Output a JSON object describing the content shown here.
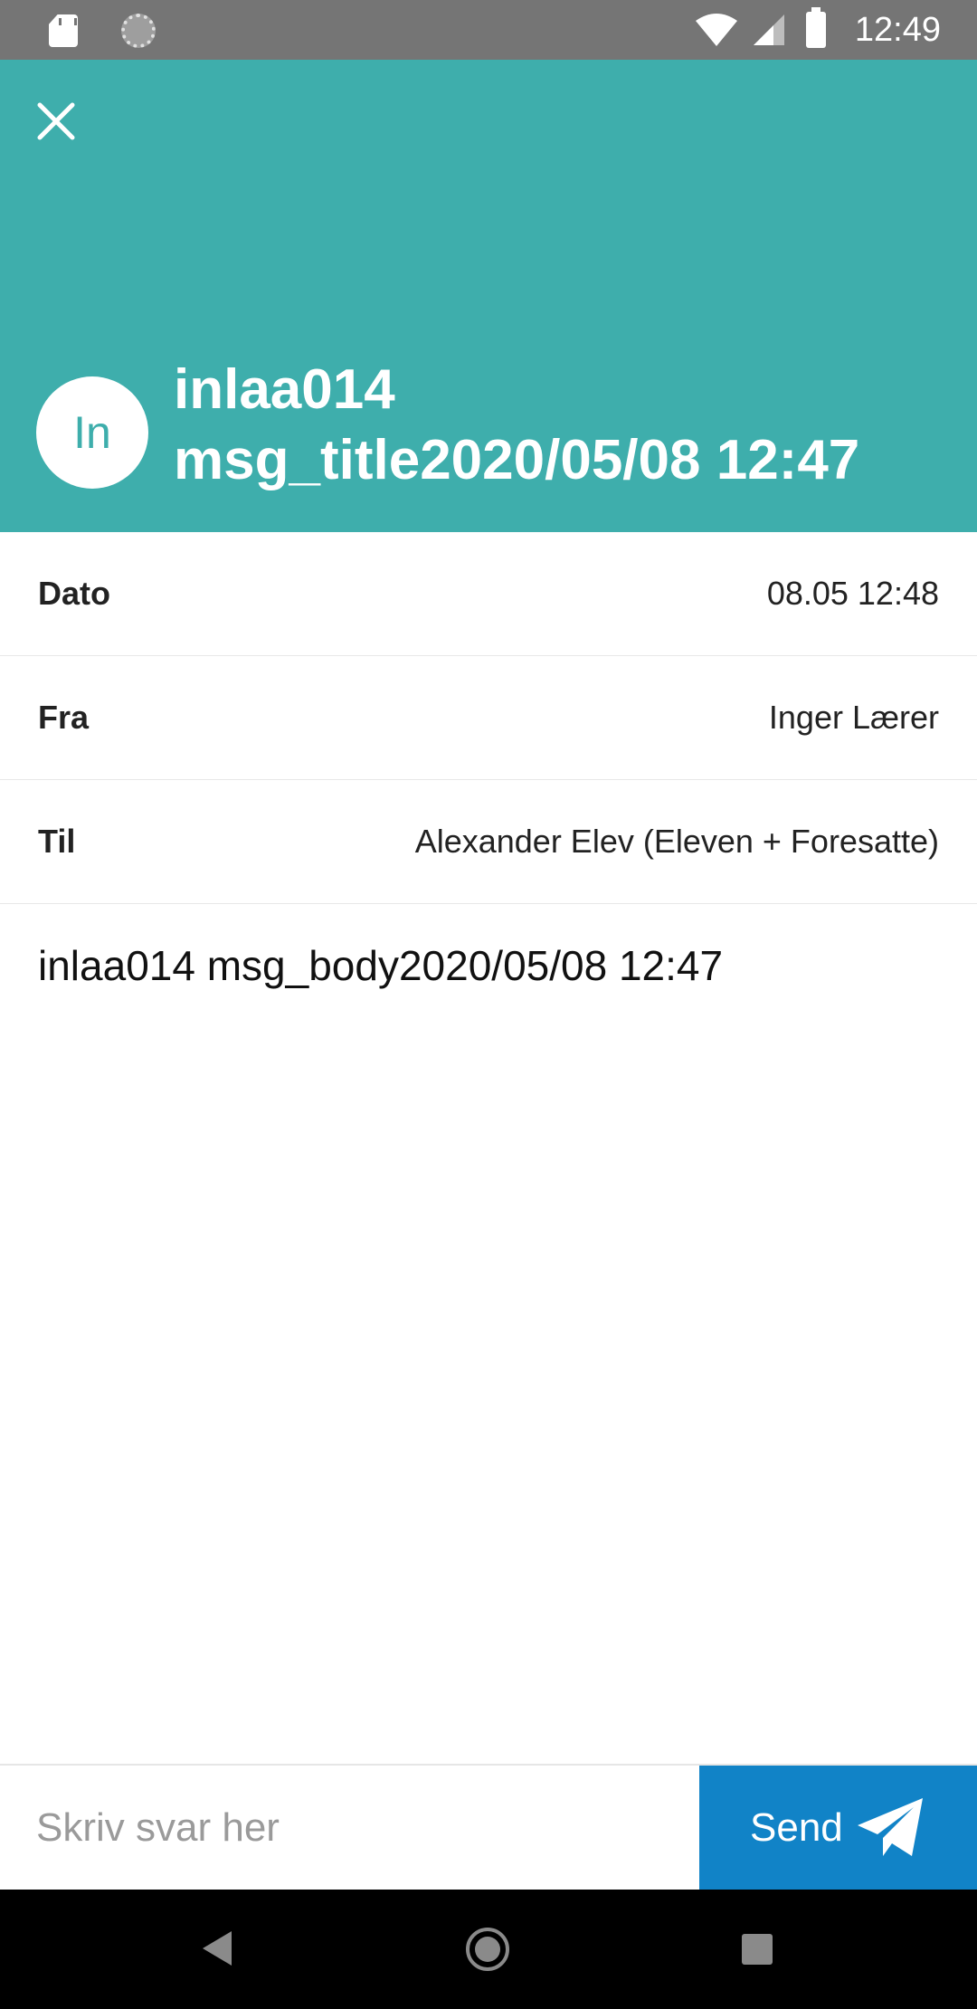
{
  "status_bar": {
    "time": "12:49",
    "icons": [
      "sd-card-icon",
      "spinner-icon",
      "wifi-icon",
      "signal-icon",
      "battery-icon"
    ]
  },
  "header": {
    "close_icon": "close-icon",
    "avatar_initials": "In",
    "title_line1": "inlaa014",
    "title_line2": "msg_title2020/05/08 12:47",
    "background_color": "#3eaeac"
  },
  "details": {
    "date_label": "Dato",
    "date_value": "08.05 12:48",
    "from_label": "Fra",
    "from_value": "Inger Lærer",
    "to_label": "Til",
    "to_value": "Alexander Elev (Eleven + Foresatte)"
  },
  "message": {
    "body": "inlaa014 msg_body2020/05/08 12:47"
  },
  "reply": {
    "placeholder": "Skriv svar her",
    "send_label": "Send",
    "send_icon": "paper-plane-icon",
    "send_color": "#1183c7"
  },
  "nav_bar": {
    "icons": [
      "back-icon",
      "home-icon",
      "recent-apps-icon"
    ]
  }
}
